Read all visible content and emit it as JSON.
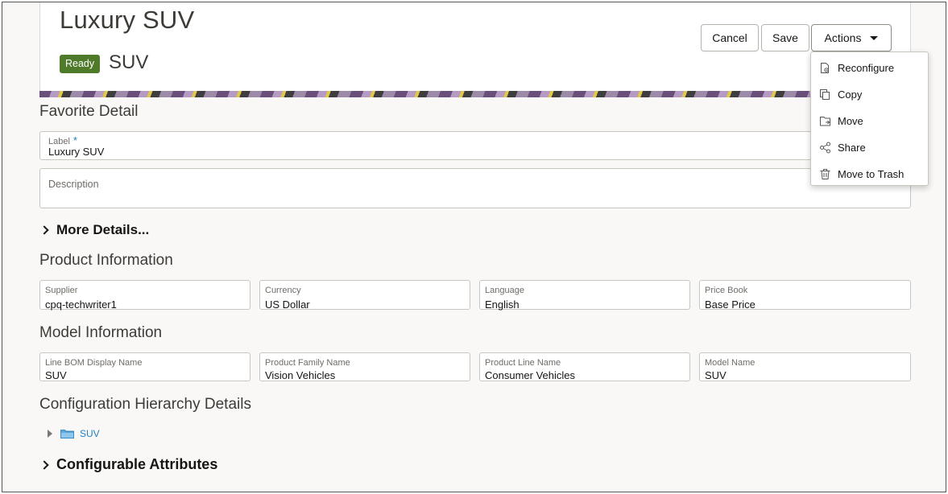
{
  "header": {
    "title": "Luxury SUV",
    "status": "Ready",
    "subtitle": "SUV",
    "cancel_label": "Cancel",
    "save_label": "Save",
    "actions_label": "Actions"
  },
  "actions_menu": {
    "items": [
      {
        "label": "Reconfigure",
        "icon": "reconfigure-icon"
      },
      {
        "label": "Copy",
        "icon": "copy-icon"
      },
      {
        "label": "Move",
        "icon": "move-icon"
      },
      {
        "label": "Share",
        "icon": "share-icon"
      },
      {
        "label": "Move to Trash",
        "icon": "trash-icon"
      }
    ]
  },
  "favorite_detail": {
    "heading": "Favorite Detail",
    "label_field": {
      "label": "Label",
      "required_mark": "*",
      "value": "Luxury SUV"
    },
    "description_field": {
      "label": "Description",
      "value": ""
    },
    "more_details": "More Details..."
  },
  "product_information": {
    "heading": "Product Information",
    "fields": [
      {
        "label": "Supplier",
        "value": "cpq-techwriter1"
      },
      {
        "label": "Currency",
        "value": "US Dollar"
      },
      {
        "label": "Language",
        "value": "English"
      },
      {
        "label": "Price Book",
        "value": "Base Price"
      }
    ]
  },
  "model_information": {
    "heading": "Model Information",
    "fields": [
      {
        "label": "Line BOM Display Name",
        "value": "SUV"
      },
      {
        "label": "Product Family Name",
        "value": "Vision Vehicles"
      },
      {
        "label": "Product Line Name",
        "value": "Consumer Vehicles"
      },
      {
        "label": "Model Name",
        "value": "SUV"
      }
    ]
  },
  "configuration_hierarchy": {
    "heading": "Configuration Hierarchy Details",
    "tree_root": "SUV"
  },
  "configurable_attributes": {
    "label": "Configurable Attributes"
  },
  "colors": {
    "ready_badge": "#4e7a2a",
    "link": "#227fc0"
  }
}
